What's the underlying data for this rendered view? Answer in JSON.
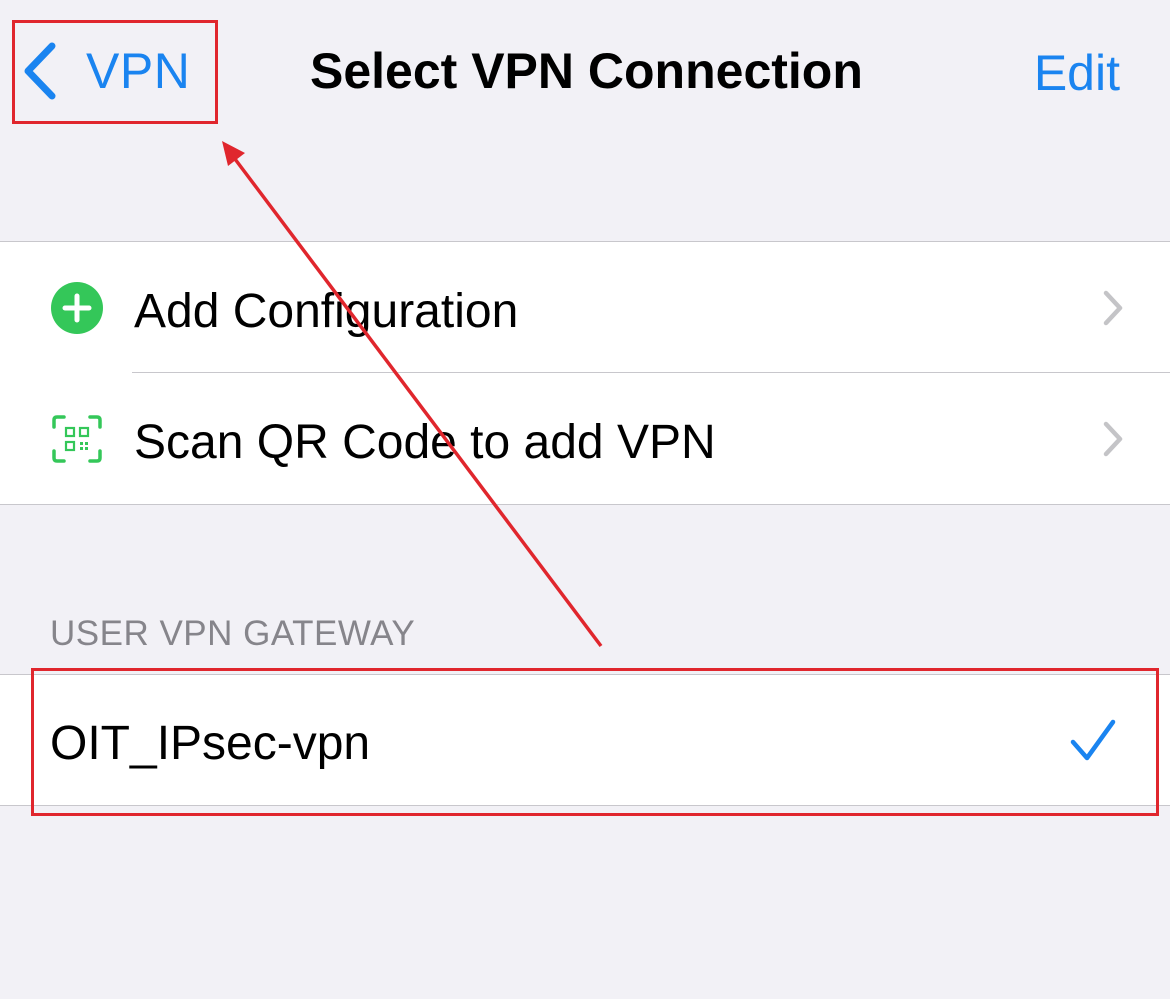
{
  "nav": {
    "back_label": "VPN",
    "title": "Select VPN Connection",
    "edit_label": "Edit"
  },
  "actions": [
    {
      "label": "Add Configuration",
      "icon": "plus-circle-icon"
    },
    {
      "label": "Scan QR Code to add VPN",
      "icon": "qr-scan-icon"
    }
  ],
  "section": {
    "header": "USER VPN GATEWAY",
    "items": [
      {
        "label": "OIT_IPsec-vpn",
        "selected": true
      }
    ]
  },
  "colors": {
    "accent": "#1a84f0",
    "green": "#34c759",
    "annotation": "#e0262d",
    "background": "#f2f1f6"
  }
}
